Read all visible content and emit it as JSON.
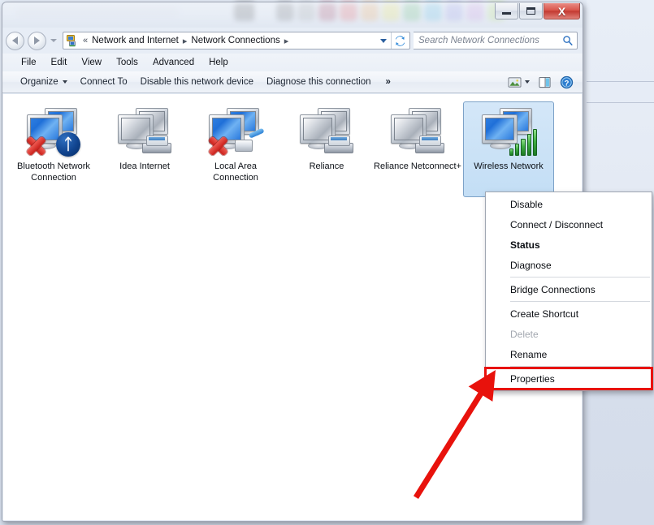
{
  "window": {
    "title": "Network Connections",
    "controls": {
      "minimize": "Minimize",
      "maximize": "Maximize",
      "close": "X"
    }
  },
  "nav": {
    "back": "Back",
    "forward": "Forward",
    "recent_pages": "Recent Pages",
    "address_icon": "network-icon",
    "breadcrumbs": [
      "Network and Internet",
      "Network Connections"
    ],
    "leading_chevrons": "«",
    "separator": "▸",
    "refresh": "Refresh"
  },
  "search": {
    "placeholder": "Search Network Connections",
    "icon": "search-icon"
  },
  "menubar": {
    "items": [
      "File",
      "Edit",
      "View",
      "Tools",
      "Advanced",
      "Help"
    ]
  },
  "toolbar": {
    "organize": "Organize",
    "connect_to": "Connect To",
    "disable_device": "Disable this network device",
    "diagnose": "Diagnose this connection",
    "overflow": "»",
    "change_view": "change-view-icon",
    "show_preview_pane": "preview-pane-icon",
    "help": "help-icon"
  },
  "connections": [
    {
      "name": "Bluetooth Network Connection",
      "icon": "network-monitors-icon",
      "screen": "blue",
      "badges": [
        "red-x-icon",
        "bluetooth-icon"
      ],
      "selected": false
    },
    {
      "name": "Idea Internet",
      "icon": "network-monitors-icon",
      "screen": "gray",
      "badges": [
        "modem-phone-icon"
      ],
      "selected": false
    },
    {
      "name": "Local Area Connection",
      "icon": "network-monitors-icon",
      "screen": "blue",
      "badges": [
        "red-x-icon",
        "rj45-plug-icon"
      ],
      "selected": false
    },
    {
      "name": "Reliance",
      "icon": "network-monitors-icon",
      "screen": "gray",
      "badges": [
        "modem-phone-icon"
      ],
      "selected": false
    },
    {
      "name": "Reliance Netconnect+",
      "icon": "network-monitors-icon",
      "screen": "gray",
      "badges": [
        "modem-phone-icon"
      ],
      "selected": false
    },
    {
      "name": "Wireless Network",
      "icon": "network-monitors-icon",
      "screen": "blue",
      "badges": [
        "wifi-signal-icon"
      ],
      "selected": true
    }
  ],
  "context_menu": {
    "items": [
      {
        "label": "Disable",
        "shield": true,
        "bold": false,
        "disabled": false,
        "highlighted": false,
        "separator_after": false
      },
      {
        "label": "Connect / Disconnect",
        "shield": false,
        "bold": false,
        "disabled": false,
        "highlighted": false,
        "separator_after": false
      },
      {
        "label": "Status",
        "shield": false,
        "bold": true,
        "disabled": false,
        "highlighted": false,
        "separator_after": false
      },
      {
        "label": "Diagnose",
        "shield": false,
        "bold": false,
        "disabled": false,
        "highlighted": false,
        "separator_after": true
      },
      {
        "label": "Bridge Connections",
        "shield": true,
        "bold": false,
        "disabled": false,
        "highlighted": false,
        "separator_after": true
      },
      {
        "label": "Create Shortcut",
        "shield": false,
        "bold": false,
        "disabled": false,
        "highlighted": false,
        "separator_after": false
      },
      {
        "label": "Delete",
        "shield": true,
        "bold": false,
        "disabled": true,
        "highlighted": false,
        "separator_after": false
      },
      {
        "label": "Rename",
        "shield": true,
        "bold": false,
        "disabled": false,
        "highlighted": false,
        "separator_after": true
      },
      {
        "label": "Properties",
        "shield": true,
        "bold": false,
        "disabled": false,
        "highlighted": true,
        "separator_after": false
      }
    ]
  },
  "annotation": {
    "type": "arrow",
    "color": "#e8120c",
    "points_to": "Properties"
  },
  "colors": {
    "highlight_box": "#e8120c",
    "selection_fill": "#c9e1f6",
    "selection_border": "#7da2c8",
    "close_button": "#c33a31",
    "accent_blue": "#2b5f9e"
  },
  "background_swatches": [
    "#3a3a3a",
    "#f2f2f2",
    "#4a4a4a",
    "#8c8c8c",
    "#8e1030",
    "#e03030",
    "#f0922a",
    "#ece02c",
    "#38a84a",
    "#2aa8d8",
    "#7a7ae0",
    "#c07ad8",
    "#a8d84a"
  ]
}
